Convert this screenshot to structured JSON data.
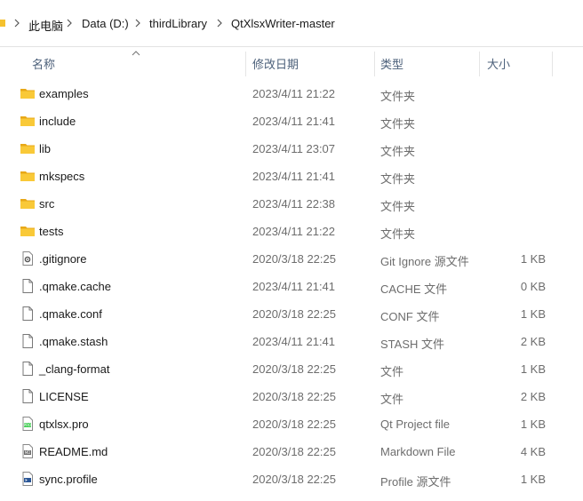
{
  "breadcrumb": [
    "此电脑",
    "Data (D:)",
    "thirdLibrary",
    "QtXlsxWriter-master"
  ],
  "columns": {
    "name": "名称",
    "date": "修改日期",
    "type": "类型",
    "size": "大小"
  },
  "files": [
    {
      "name": "examples",
      "date": "2023/4/11 21:22",
      "type": "文件夹",
      "size": "",
      "icon": "folder-icon"
    },
    {
      "name": "include",
      "date": "2023/4/11 21:41",
      "type": "文件夹",
      "size": "",
      "icon": "folder-icon"
    },
    {
      "name": "lib",
      "date": "2023/4/11 23:07",
      "type": "文件夹",
      "size": "",
      "icon": "folder-icon"
    },
    {
      "name": "mkspecs",
      "date": "2023/4/11 21:41",
      "type": "文件夹",
      "size": "",
      "icon": "folder-icon"
    },
    {
      "name": "src",
      "date": "2023/4/11 22:38",
      "type": "文件夹",
      "size": "",
      "icon": "folder-icon"
    },
    {
      "name": "tests",
      "date": "2023/4/11 21:22",
      "type": "文件夹",
      "size": "",
      "icon": "folder-icon"
    },
    {
      "name": ".gitignore",
      "date": "2020/3/18 22:25",
      "type": "Git Ignore 源文件",
      "size": "1 KB",
      "icon": "gear-file-icon"
    },
    {
      "name": ".qmake.cache",
      "date": "2023/4/11 21:41",
      "type": "CACHE 文件",
      "size": "0 KB",
      "icon": "file-icon"
    },
    {
      "name": ".qmake.conf",
      "date": "2020/3/18 22:25",
      "type": "CONF 文件",
      "size": "1 KB",
      "icon": "file-icon"
    },
    {
      "name": ".qmake.stash",
      "date": "2023/4/11 21:41",
      "type": "STASH 文件",
      "size": "2 KB",
      "icon": "file-icon"
    },
    {
      "name": "_clang-format",
      "date": "2020/3/18 22:25",
      "type": "文件",
      "size": "1 KB",
      "icon": "file-icon"
    },
    {
      "name": "LICENSE",
      "date": "2020/3/18 22:25",
      "type": "文件",
      "size": "2 KB",
      "icon": "file-icon"
    },
    {
      "name": "qtxlsx.pro",
      "date": "2020/3/18 22:25",
      "type": "Qt Project file",
      "size": "1 KB",
      "icon": "qt-pro-file-icon"
    },
    {
      "name": "README.md",
      "date": "2020/3/18 22:25",
      "type": "Markdown File",
      "size": "4 KB",
      "icon": "markdown-file-icon"
    },
    {
      "name": "sync.profile",
      "date": "2020/3/18 22:25",
      "type": "Profile 源文件",
      "size": "1 KB",
      "icon": "script-file-icon"
    }
  ]
}
